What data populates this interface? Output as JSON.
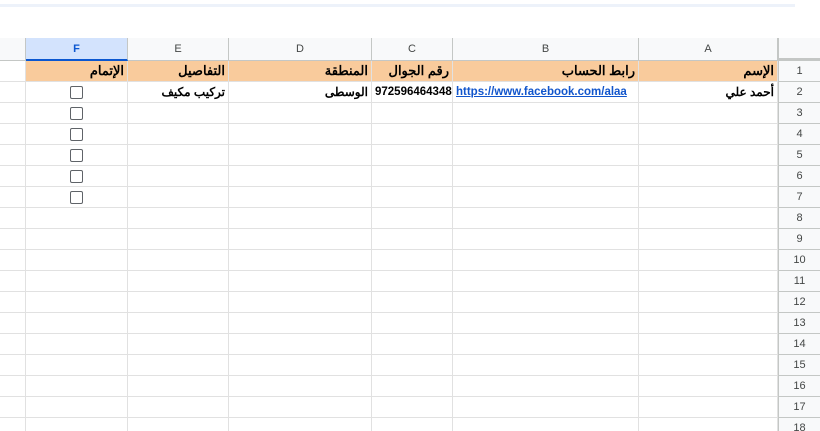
{
  "columns": [
    "F",
    "E",
    "D",
    "C",
    "B",
    "A"
  ],
  "rows": [
    "1",
    "2",
    "3",
    "4",
    "5",
    "6",
    "7",
    "8",
    "9",
    "10",
    "11",
    "12",
    "13",
    "14",
    "15",
    "16",
    "17",
    "18"
  ],
  "header_row": {
    "A": "الإسم",
    "B": "رابط الحساب",
    "C": "رقم الجوال",
    "D": "المنطقة",
    "E": "التفاصيل",
    "F": "الإتمام"
  },
  "data_row": {
    "A": "أحمد علي",
    "B": "https://www.facebook.com/alaa",
    "C": "972596464348",
    "D": "الوسطى",
    "E": "تركيب مكيف"
  },
  "selected_column": "F",
  "header_color": "#f9cb9c",
  "checkbox_rows": [
    2,
    3,
    4,
    5,
    6,
    7
  ]
}
